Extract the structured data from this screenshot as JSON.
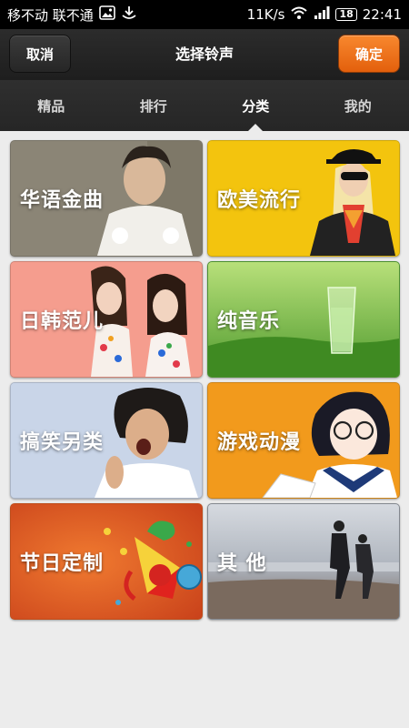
{
  "status_bar": {
    "carriers": "移不动 联不通",
    "speed": "11K/s",
    "battery": "18",
    "time": "22:41"
  },
  "header": {
    "cancel_label": "取消",
    "title": "选择铃声",
    "confirm_label": "确定",
    "confirm_color": "#f07820"
  },
  "tabs": [
    {
      "label": "精品",
      "active": false
    },
    {
      "label": "排行",
      "active": false
    },
    {
      "label": "分类",
      "active": true
    },
    {
      "label": "我的",
      "active": false
    }
  ],
  "categories": [
    {
      "label": "华语金曲",
      "color": "#9a9080"
    },
    {
      "label": "欧美流行",
      "color": "#f2c40c"
    },
    {
      "label": "日韩范儿",
      "color": "#f49a8a"
    },
    {
      "label": "纯音乐",
      "color": "#5aa83a"
    },
    {
      "label": "搞笑另类",
      "color": "#c8d4e8"
    },
    {
      "label": "游戏动漫",
      "color": "#f09a1e"
    },
    {
      "label": "节日定制",
      "color": "#e05a1e"
    },
    {
      "label": "其 他",
      "color": "#9aa0a8"
    }
  ]
}
